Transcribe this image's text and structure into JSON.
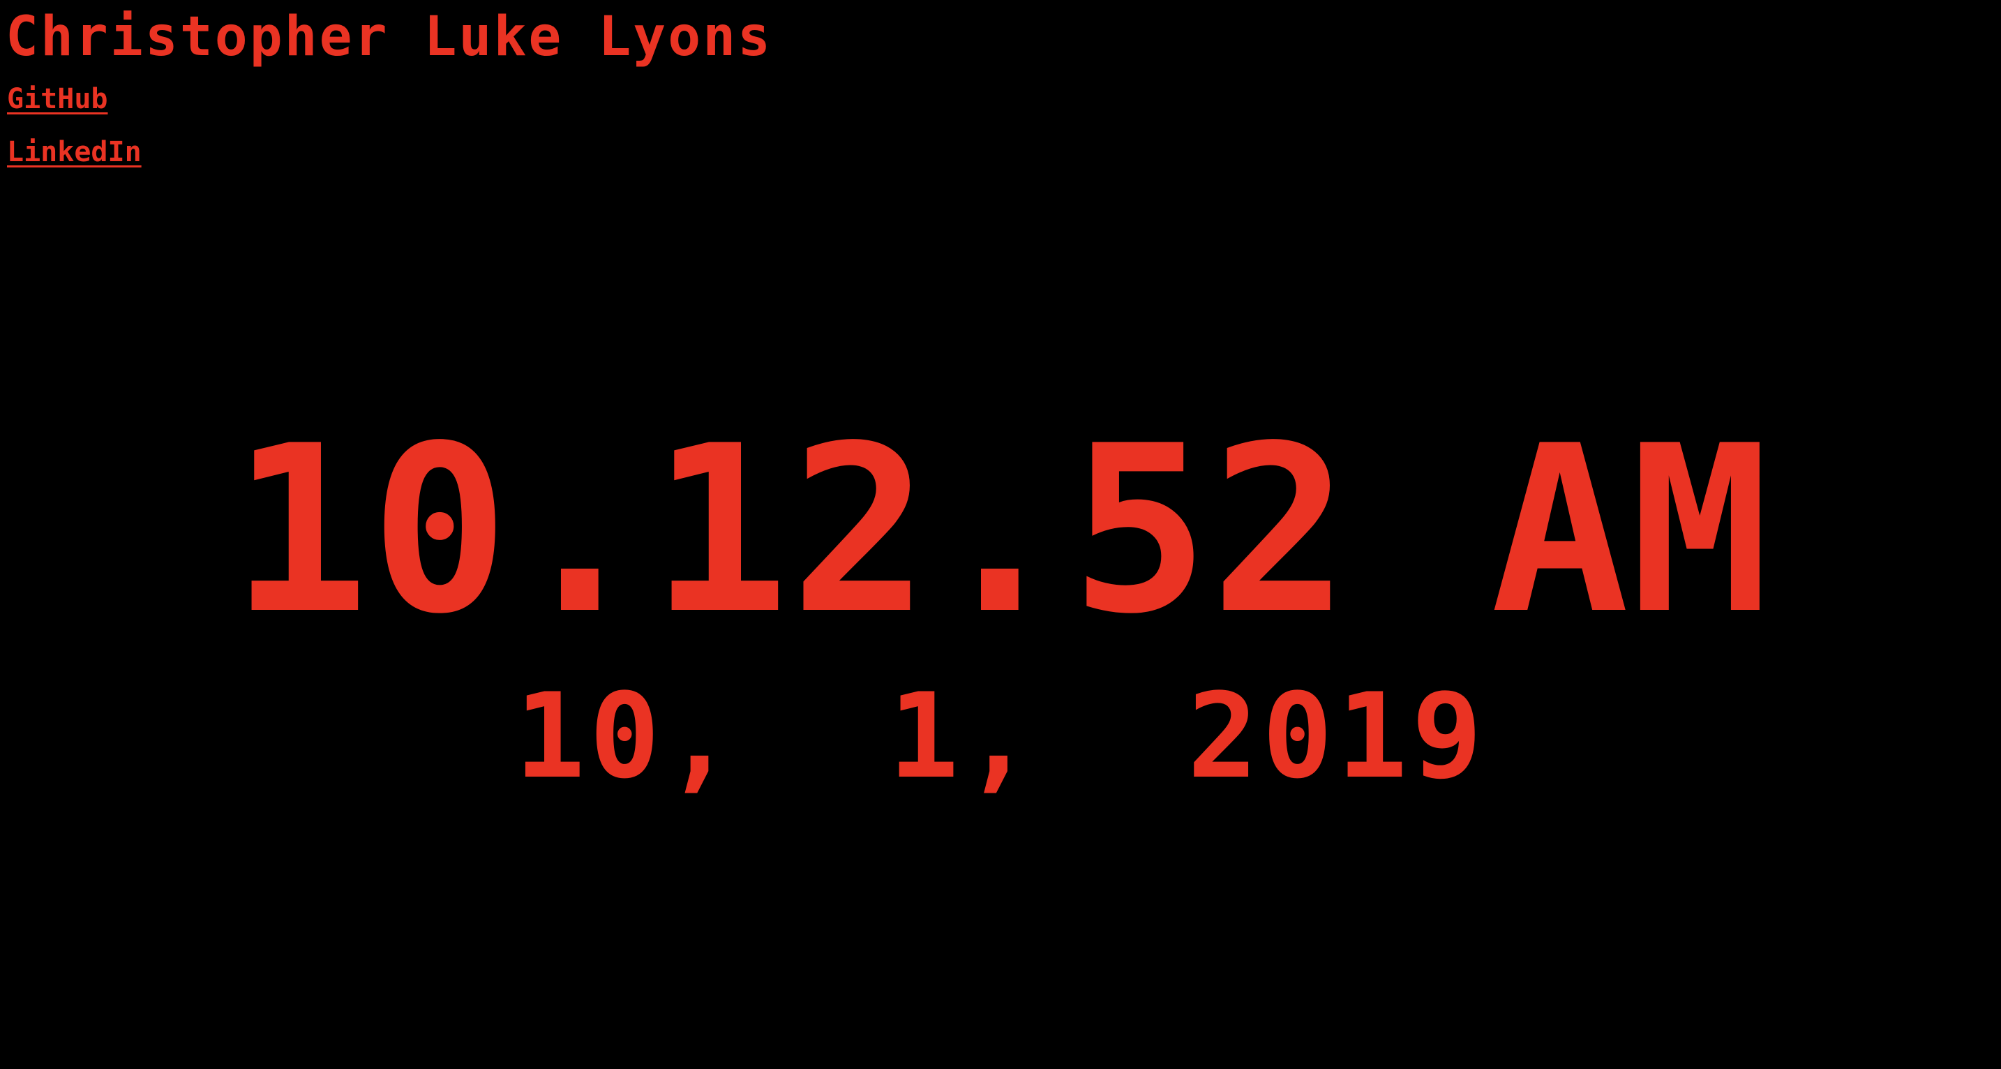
{
  "header": {
    "name": "Christopher Luke Lyons"
  },
  "links": {
    "github_label": "GitHub",
    "linkedin_label": "LinkedIn"
  },
  "clock": {
    "time": "10.12.52 AM",
    "date": "10,  1,  2019"
  },
  "colors": {
    "background": "#000000",
    "accent": "#ea3323"
  }
}
